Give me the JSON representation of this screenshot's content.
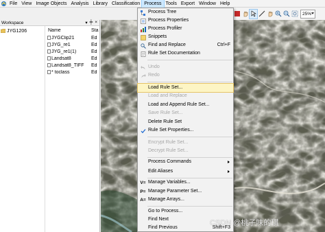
{
  "menubar": {
    "items": [
      "File",
      "View",
      "Image Objects",
      "Analysis",
      "Library",
      "Classification",
      "Process",
      "Tools",
      "Export",
      "Window",
      "Help"
    ],
    "active": "Process"
  },
  "toolbar": {
    "buttons": [
      "stop-icon",
      "pan-hand-icon",
      "pointer-icon",
      "line-icon",
      "pan-hand-icon-2",
      "zoom-in-icon",
      "zoom-out-icon",
      "zoom-area-icon"
    ],
    "zoom_value": "25%"
  },
  "workspace": {
    "title": "Workspace",
    "controls": [
      "▾",
      "╪",
      "×"
    ],
    "root": "JYG1206",
    "columns": [
      "Name",
      "Sta"
    ],
    "rows": [
      {
        "name": "JYGClip21",
        "status": "Ed"
      },
      {
        "name": "JYG_re1",
        "status": "Ed"
      },
      {
        "name": "JYG_re1(1)",
        "status": "Ed"
      },
      {
        "name": "Landsat8",
        "status": "Ed"
      },
      {
        "name": "Landsat8_TIFF",
        "status": "Ed"
      },
      {
        "name": "* toclass",
        "status": "Ed"
      }
    ]
  },
  "process_menu": {
    "items": [
      {
        "label": "Process Tree",
        "icon": "process-tree-icon",
        "enabled": true
      },
      {
        "label": "Process Properties",
        "icon": "process-properties-icon",
        "enabled": true
      },
      {
        "label": "Process Profiler",
        "icon": "process-profiler-icon",
        "enabled": true
      },
      {
        "label": "Snippets",
        "icon": "snippets-icon",
        "enabled": true
      },
      {
        "label": "Find and Replace",
        "icon": "find-replace-icon",
        "shortcut": "Ctrl+F",
        "enabled": true
      },
      {
        "label": "Rule Set Documentation",
        "icon": "documentation-icon",
        "enabled": true
      },
      {
        "label": "Undo",
        "icon": "undo-icon",
        "enabled": false
      },
      {
        "label": "Redo",
        "icon": "redo-icon",
        "enabled": false
      },
      {
        "label": "Load Rule Set...",
        "enabled": true,
        "highlighted": true
      },
      {
        "label": "Load and Replace",
        "enabled": false
      },
      {
        "label": "Load and Append Rule Set...",
        "enabled": true
      },
      {
        "label": "Save Rule Set...",
        "enabled": false
      },
      {
        "label": "Delete Rule Set",
        "enabled": true
      },
      {
        "label": "Rule Set Properties...",
        "icon": "checkmark-icon",
        "enabled": true
      },
      {
        "label": "Encrypt Rule Set...",
        "enabled": false
      },
      {
        "label": "Decrypt Rule Set...",
        "enabled": false
      },
      {
        "label": "Process Commands",
        "submenu": true,
        "enabled": true
      },
      {
        "label": "Edit Aliases",
        "submenu": true,
        "enabled": true
      },
      {
        "label": "Manage Variables...",
        "icon_text": "V=",
        "enabled": true
      },
      {
        "label": "Manage Parameter Set...",
        "icon_text": "P=",
        "enabled": true
      },
      {
        "label": "Manage Arrays...",
        "icon_text": "A=",
        "enabled": true
      },
      {
        "label": "Go to Process...",
        "enabled": true
      },
      {
        "label": "Find Next",
        "enabled": true
      },
      {
        "label": "Find Previous",
        "shortcut": "Shift+F3",
        "enabled": true
      }
    ]
  },
  "watermark": "CSDN @桃子味的琪",
  "colors": {
    "highlight": "#fdf5c4",
    "highlight_border": "#e5c365",
    "disabled_text": "#a6a6a6",
    "menu_active": "#cde8ff"
  }
}
